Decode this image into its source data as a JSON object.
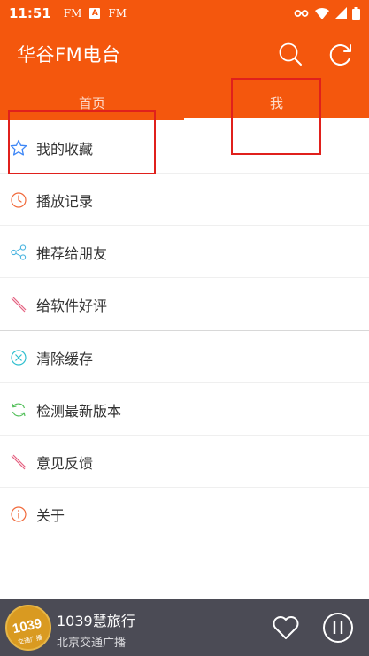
{
  "status_bar": {
    "time": "11:51",
    "notifications": [
      "FM",
      "A",
      "FM"
    ],
    "icons": [
      "key-icon",
      "wifi-icon",
      "signal-icon",
      "battery-icon"
    ]
  },
  "header": {
    "title": "华谷FM电台",
    "search_icon": "search-icon",
    "refresh_icon": "refresh-icon"
  },
  "tabs": [
    {
      "label": "首页",
      "active": false
    },
    {
      "label": "我",
      "active": true
    }
  ],
  "menu": {
    "items": [
      {
        "label": "我的收藏",
        "icon": "star-icon",
        "color": "#3d86f6"
      },
      {
        "label": "播放记录",
        "icon": "clock-icon",
        "color": "#f1693a"
      },
      {
        "label": "推荐给朋友",
        "icon": "share-icon",
        "color": "#4cb5e0"
      },
      {
        "label": "给软件好评",
        "icon": "pen-icon",
        "color": "#e6607f"
      },
      {
        "label": "清除缓存",
        "icon": "clear-icon",
        "color": "#2fbfcf"
      },
      {
        "label": "检测最新版本",
        "icon": "update-icon",
        "color": "#55c05c"
      },
      {
        "label": "意见反馈",
        "icon": "feedback-icon",
        "color": "#e6607f"
      },
      {
        "label": "关于",
        "icon": "info-icon",
        "color": "#f1693a"
      }
    ]
  },
  "player": {
    "station": "1039慧旅行",
    "channel": "北京交通广播",
    "cover_text": "1039",
    "cover_sub": "交通广播"
  },
  "colors": {
    "primary": "#f4570d",
    "player_bg": "#4b4b55",
    "annotation": "#e0201c"
  }
}
